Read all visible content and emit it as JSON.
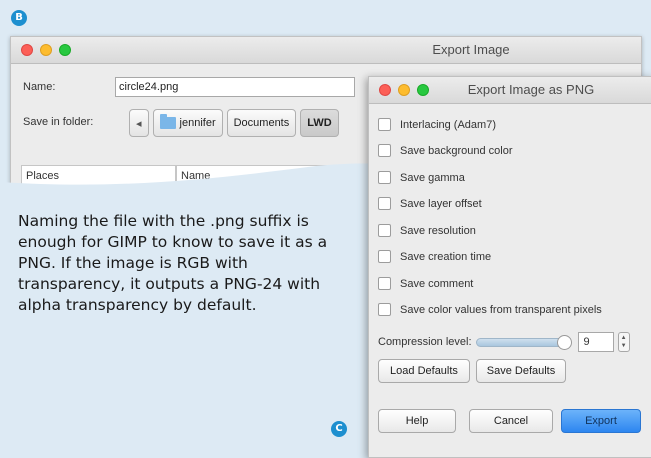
{
  "markers": {
    "b": "B",
    "c": "C"
  },
  "export_image": {
    "title": "Export Image",
    "name_label": "Name:",
    "name_value": "circle24.png",
    "folder_label": "Save in folder:",
    "path_back": "◂",
    "path": [
      "jennifer",
      "Documents",
      "LWD"
    ],
    "columns": [
      "Places",
      "Name"
    ]
  },
  "caption": "Naming the file with the .png suffix is enough for GIMP to know to save it as a PNG. If the image is RGB with transparency, it outputs a PNG-24 with alpha transparency by default.",
  "png_dialog": {
    "title": "Export Image as PNG",
    "options": [
      "Interlacing (Adam7)",
      "Save background color",
      "Save gamma",
      "Save layer offset",
      "Save resolution",
      "Save creation time",
      "Save comment",
      "Save color values from transparent pixels"
    ],
    "compression_label": "Compression level:",
    "compression_value": "9",
    "load_defaults": "Load Defaults",
    "save_defaults": "Save Defaults",
    "help": "Help",
    "cancel": "Cancel",
    "export": "Export"
  },
  "colors": {
    "marker": "#1d8fcf",
    "background": "#ddeaf4",
    "export_button": "#3b8ff2"
  }
}
